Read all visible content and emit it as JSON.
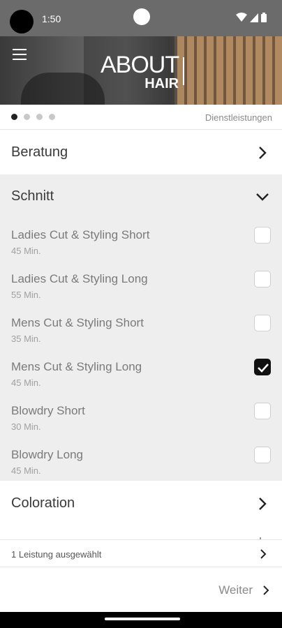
{
  "status_bar": {
    "time": "1:50"
  },
  "header": {
    "logo_about": "ABOUT",
    "logo_hair": "HAIR"
  },
  "steps": {
    "total": 4,
    "active_index": 0,
    "label": "Dienstleistungen"
  },
  "categories": [
    {
      "label": "Beratung",
      "state": "collapsed"
    },
    {
      "label": "Schnitt",
      "state": "expanded"
    },
    {
      "label": "Coloration",
      "state": "collapsed"
    }
  ],
  "services": [
    {
      "name": "Ladies Cut & Styling Short",
      "duration": "45 Min.",
      "checked": false
    },
    {
      "name": "Ladies Cut & Styling Long",
      "duration": "55 Min.",
      "checked": false
    },
    {
      "name": "Mens Cut & Styling Short",
      "duration": "35 Min.",
      "checked": false
    },
    {
      "name": "Mens Cut & Styling Long",
      "duration": "45 Min.",
      "checked": true
    },
    {
      "name": "Blowdry Short",
      "duration": "30 Min.",
      "checked": false
    },
    {
      "name": "Blowdry Long",
      "duration": "45 Min.",
      "checked": false
    }
  ],
  "footer": {
    "summary": "1 Leistung ausgewählt",
    "next_label": "Weiter"
  },
  "icons": {
    "menu": "hamburger-icon",
    "collapsed": "chevron-right-icon",
    "expanded": "chevron-down-icon",
    "checked": "checkmark-icon"
  }
}
